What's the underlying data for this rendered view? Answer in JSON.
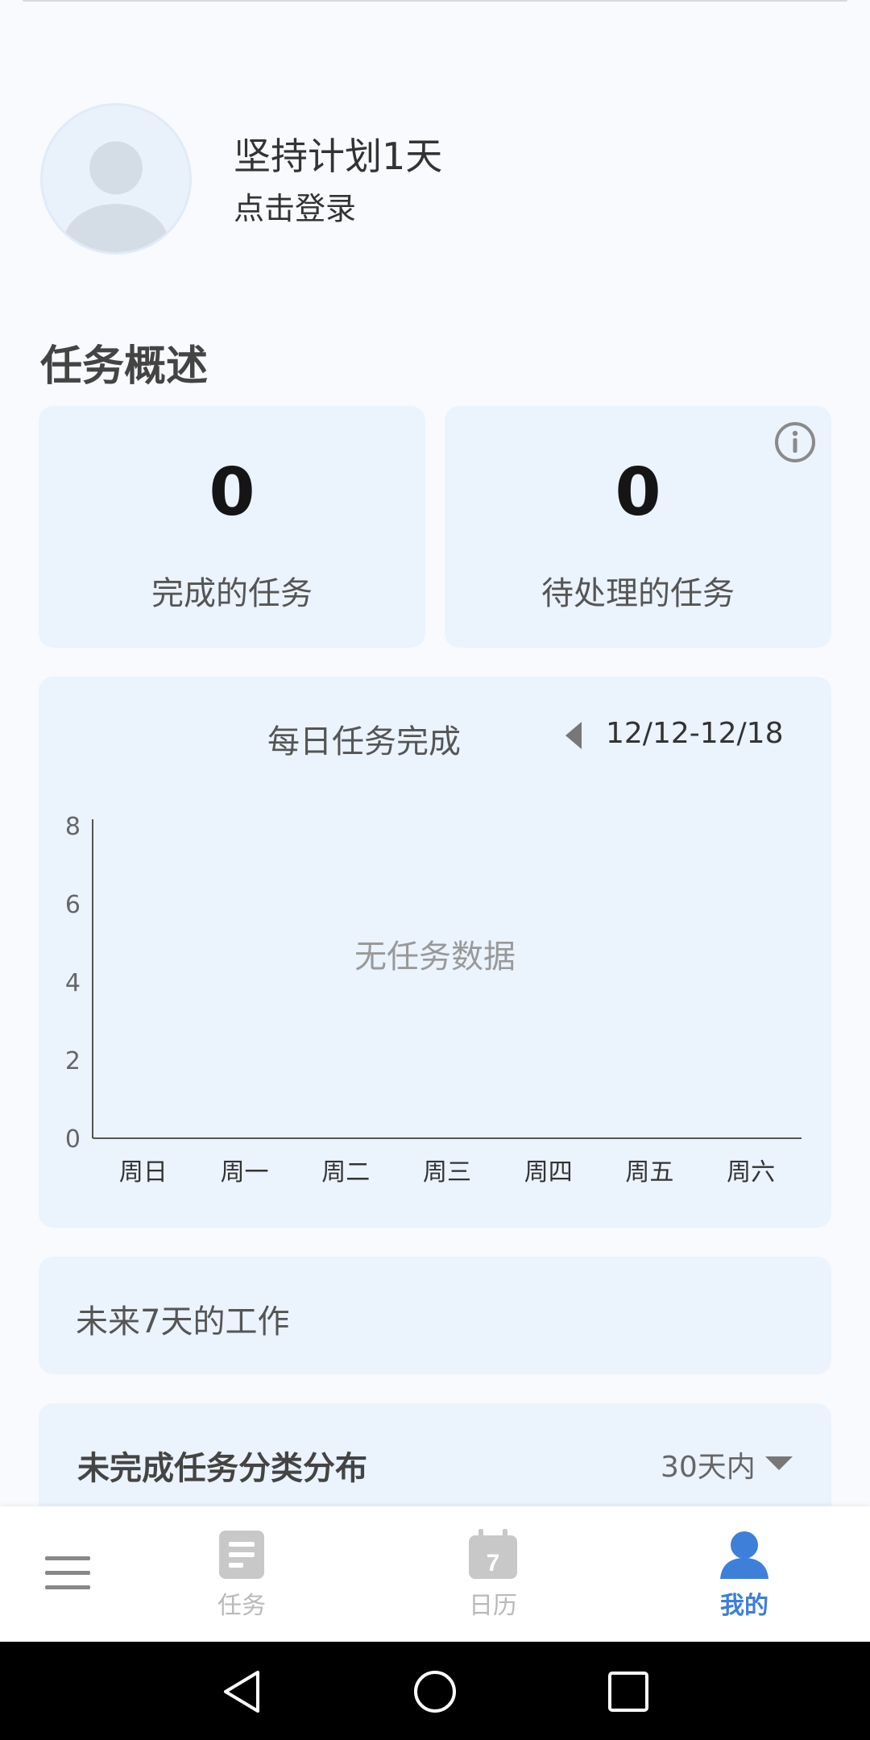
{
  "profile": {
    "title": "坚持计划1天",
    "login": "点击登录"
  },
  "overview": {
    "title": "任务概述",
    "completed": {
      "count": "0",
      "label": "完成的任务"
    },
    "pending": {
      "count": "0",
      "label": "待处理的任务"
    }
  },
  "daily_chart": {
    "title": "每日任务完成",
    "date_range": "12/12-12/18",
    "empty_text": "无任务数据"
  },
  "chart_data": {
    "type": "bar",
    "title": "每日任务完成",
    "categories": [
      "周日",
      "周一",
      "周二",
      "周三",
      "周四",
      "周五",
      "周六"
    ],
    "values": [],
    "yticks": [
      "0",
      "2",
      "4",
      "6",
      "8"
    ],
    "ylim": [
      0,
      8
    ],
    "grid": false
  },
  "upcoming": {
    "title": "未来7天的工作"
  },
  "distribution": {
    "title": "未完成任务分类分布",
    "filter": "30天内"
  },
  "bottom_nav": {
    "tasks": "任务",
    "calendar": "日历",
    "calendar_day": "7",
    "mine": "我的",
    "active_color": "#3d7fd9",
    "inactive_color": "#b9b9b9"
  }
}
